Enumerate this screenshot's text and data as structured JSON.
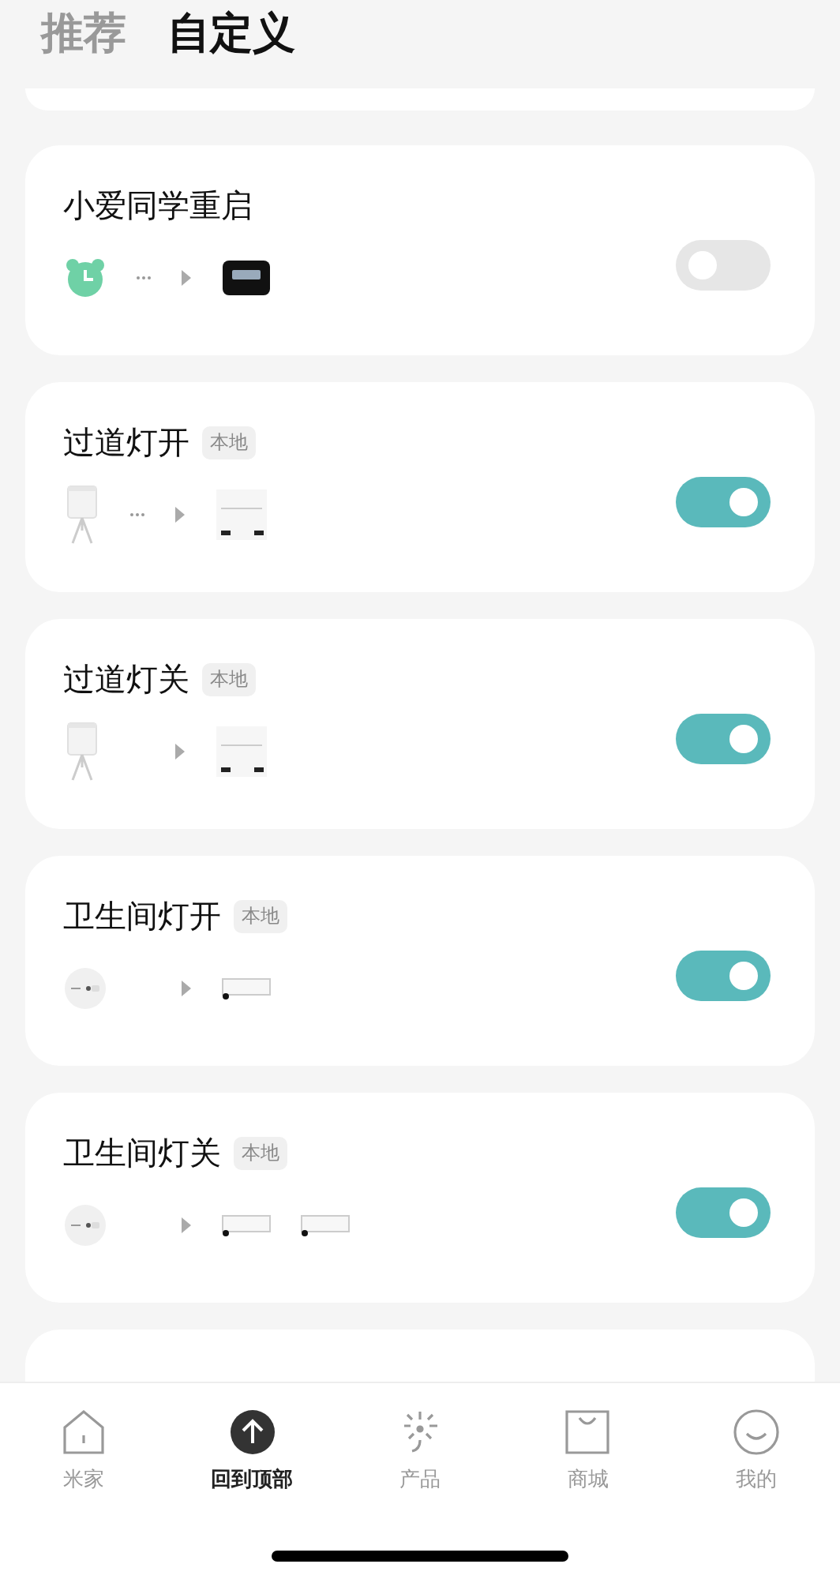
{
  "tabs": [
    {
      "label": "推荐",
      "selected": false
    },
    {
      "label": "自定义",
      "selected": true
    }
  ],
  "scenes": [
    {
      "title": "小爱同学重启",
      "on": false,
      "trigger": {
        "kind": "alarm"
      },
      "dots": true,
      "actions": [
        {
          "kind": "screen"
        }
      ]
    },
    {
      "title": "过道灯开",
      "tag": "本地",
      "on": true,
      "trigger": {
        "kind": "sensor"
      },
      "dots": true,
      "actions": [
        {
          "kind": "controller"
        }
      ]
    },
    {
      "title": "过道灯关",
      "tag": "本地",
      "on": true,
      "trigger": {
        "kind": "sensor"
      },
      "dots": false,
      "actions": [
        {
          "kind": "controller"
        }
      ]
    },
    {
      "title": "卫生间灯开",
      "tag": "本地",
      "on": true,
      "trigger": {
        "kind": "button"
      },
      "dots": false,
      "actions": [
        {
          "kind": "strip"
        }
      ]
    },
    {
      "title": "卫生间灯关",
      "tag": "本地",
      "on": true,
      "trigger": {
        "kind": "button"
      },
      "dots": false,
      "actions": [
        {
          "kind": "strip"
        },
        {
          "kind": "strip"
        }
      ]
    }
  ],
  "nav": [
    {
      "label": "米家",
      "kind": "house",
      "selected": false
    },
    {
      "label": "回到顶部",
      "kind": "top",
      "selected": true
    },
    {
      "label": "产品",
      "kind": "sparkle",
      "selected": false
    },
    {
      "label": "商城",
      "kind": "bag",
      "selected": false
    },
    {
      "label": "我的",
      "kind": "smile",
      "selected": false
    }
  ]
}
